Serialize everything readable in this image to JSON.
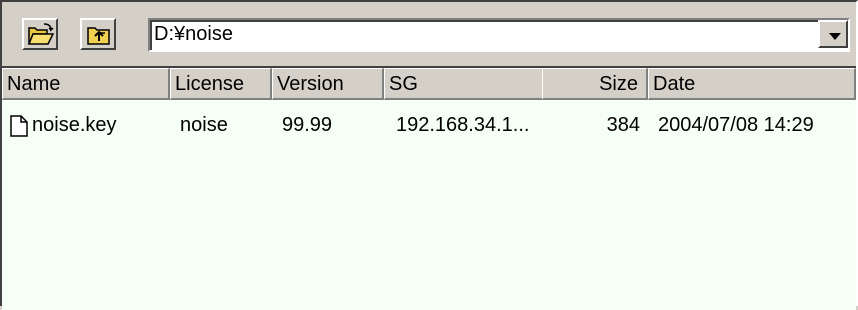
{
  "toolbar": {
    "buttons": [
      {
        "name": "open-folder-button",
        "icon": "open-folder-icon"
      },
      {
        "name": "up-folder-button",
        "icon": "up-folder-icon"
      }
    ],
    "path_value": "D:¥noise"
  },
  "list": {
    "columns": [
      "Name",
      "License",
      "Version",
      "SG",
      "Size",
      "Date"
    ],
    "rows": [
      {
        "name": "noise.key",
        "license": "noise",
        "version": "99.99",
        "sg": "192.168.34.1...",
        "size": "384",
        "date": "2004/07/08 14:29",
        "icon": "file-icon"
      }
    ]
  }
}
